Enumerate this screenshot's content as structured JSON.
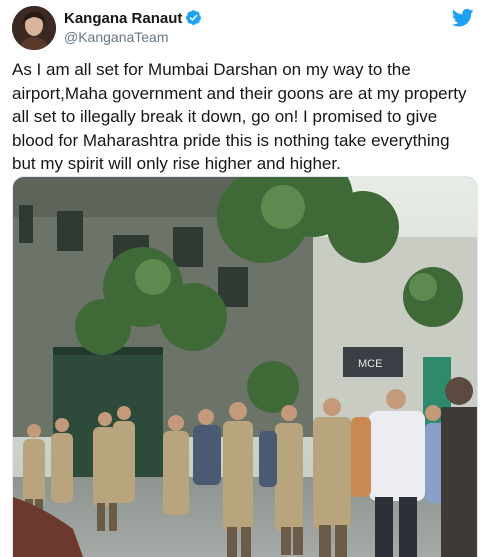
{
  "author": {
    "display_name": "Kangana Ranaut",
    "handle": "@KanganaTeam",
    "verified": true,
    "avatar_icon": "profile-photo",
    "verified_icon": "verified-badge-icon"
  },
  "platform_icon": "twitter-bird-icon",
  "tweet": {
    "text": "As I am all set for Mumbai Darshan on my way to the airport,Maha government and their goons are at my property all set to illegally break it down, go on! I promised to give blood for Maharashtra pride this is nothing take everything but my spirit will only rise higher and higher."
  },
  "media": {
    "sign_text": "MCE"
  },
  "colors": {
    "twitter_blue": "#1da1f2",
    "text": "#14171a",
    "muted": "#657786"
  }
}
